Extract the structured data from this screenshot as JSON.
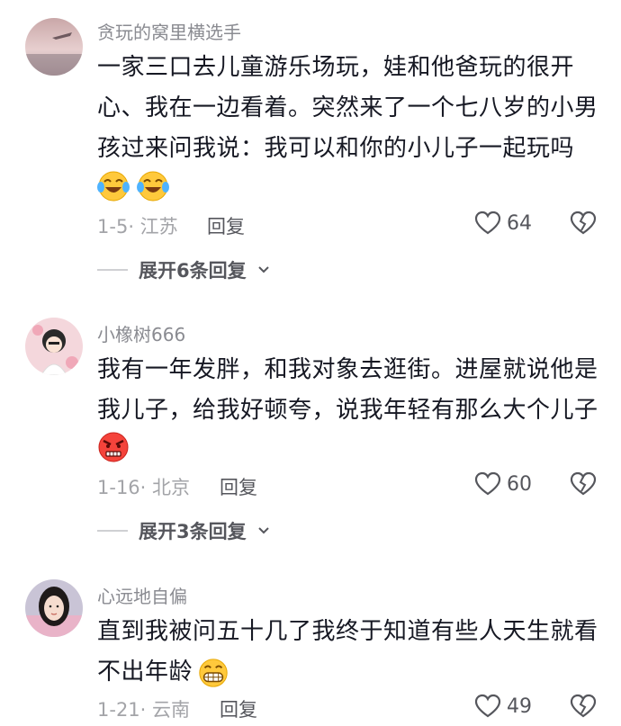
{
  "colors": {
    "text": "#161823",
    "meta": "#a3a4a8",
    "username": "#8a8b91",
    "action": "#55565c"
  },
  "comments": [
    {
      "username": "贪玩的窝里横选手",
      "text_lines": [
        "一家三口去儿童游乐场玩，娃和他爸玩的很开",
        "心、我在一边看着。突然来了一个七八岁的小男",
        "孩过来问我说：我可以和你的小儿子一起玩吗"
      ],
      "emojis": [
        "crying-laughing",
        "crying-laughing"
      ],
      "date": "1-5",
      "location": "江苏",
      "reply_label": "回复",
      "likes": "64",
      "expand_label": "展开6条回复"
    },
    {
      "username": "小橡树666",
      "text_lines": [
        "我有一年发胖，和我对象去逛街。进屋就说他是",
        "我儿子，给我好顿夸，说我年轻有那么大个儿子"
      ],
      "emojis": [
        "angry-face"
      ],
      "date": "1-16",
      "location": "北京",
      "reply_label": "回复",
      "likes": "60",
      "expand_label": "展开3条回复"
    },
    {
      "username": "心远地自偏",
      "text_lines": [
        "直到我被问五十几了我终于知道有些人天生就看",
        "不出年龄"
      ],
      "emojis": [
        "grinning-face"
      ],
      "date": "1-21",
      "location": "云南",
      "reply_label": "回复",
      "likes": "49"
    }
  ]
}
